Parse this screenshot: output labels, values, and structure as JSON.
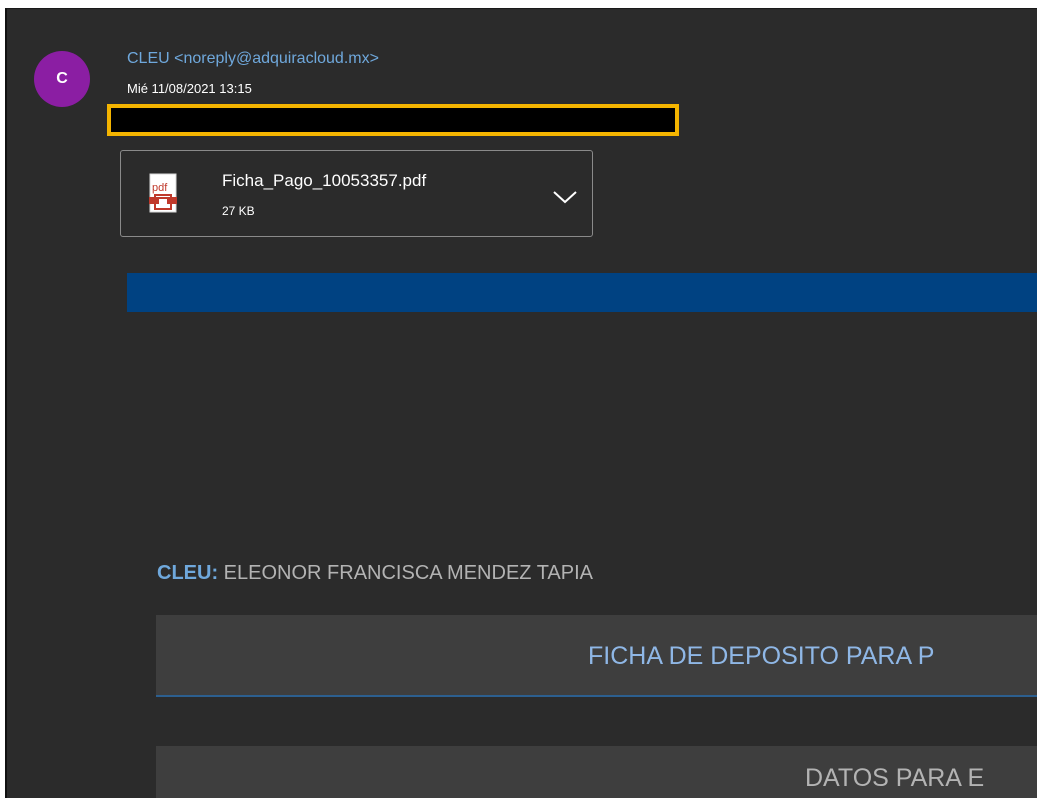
{
  "email": {
    "avatar_initial": "C",
    "sender": "CLEU <noreply@adquiracloud.mx>",
    "date": "Mié 11/08/2021 13:15"
  },
  "attachment": {
    "icon": "pdf-file-icon",
    "filename": "Ficha_Pago_10053357.pdf",
    "size": "27 KB"
  },
  "body": {
    "cleu_label": "CLEU:",
    "cleu_value": "ELEONOR FRANCISCA MENDEZ TAPIA",
    "ficha_heading": "FICHA DE DEPOSITO PARA P",
    "datos_heading": "DATOS PARA E"
  },
  "colors": {
    "avatar": "#8b1ea3",
    "accent_blue": "#004282",
    "link_blue": "#6fa8dc",
    "redaction_border": "#f4b400"
  }
}
